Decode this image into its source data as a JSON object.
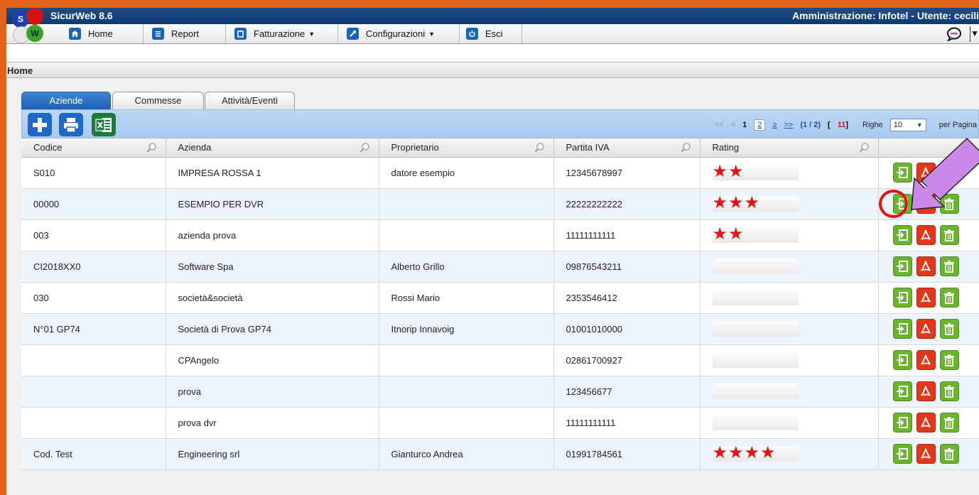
{
  "app": {
    "title": "SicurWeb 8.6",
    "admin_info": "Amministrazione: Infotel - Utente: cecili",
    "logo_letters": [
      "S",
      "W"
    ]
  },
  "menu": {
    "items": [
      {
        "label": "Home",
        "icon": "home-icon",
        "dropdown": false
      },
      {
        "label": "Report",
        "icon": "report-icon",
        "dropdown": false
      },
      {
        "label": "Fatturazione",
        "icon": "clipboard-icon",
        "dropdown": true
      },
      {
        "label": "Configurazioni",
        "icon": "wrench-icon",
        "dropdown": true
      },
      {
        "label": "Esci",
        "icon": "power-icon",
        "dropdown": false
      }
    ]
  },
  "page": {
    "title": "Home"
  },
  "tabs": [
    {
      "label": "Aziende",
      "active": true
    },
    {
      "label": "Commesse",
      "active": false
    },
    {
      "label": "Attività/Eventi",
      "active": false
    }
  ],
  "pager": {
    "first": "<<",
    "prev": "<",
    "current": "1",
    "page2": "2",
    "next": "≥",
    "last": ">>",
    "info": "(1 / 2)",
    "total_open": "[",
    "total": "11",
    "total_close": "]",
    "rows_label": "Righe",
    "per_page": "10",
    "per_page_label": "per Pagina"
  },
  "table": {
    "columns": [
      "Codice",
      "Azienda",
      "Proprietario",
      "Partita IVA",
      "Rating"
    ],
    "rows": [
      {
        "codice": "S010",
        "azienda": "IMPRESA ROSSA 1",
        "proprietario": "datore esempio",
        "piva": "12345678997",
        "rating": 2
      },
      {
        "codice": "00000",
        "azienda": "ESEMPIO PER DVR",
        "proprietario": "",
        "piva": "22222222222",
        "rating": 3
      },
      {
        "codice": "003",
        "azienda": "azienda prova",
        "proprietario": "",
        "piva": "11111111111",
        "rating": 2
      },
      {
        "codice": "CI2018XX0",
        "azienda": "Software Spa",
        "proprietario": "Alberto Grillo",
        "piva": "09876543211",
        "rating": 0
      },
      {
        "codice": "030",
        "azienda": "società&società",
        "proprietario": "Rossi Mario",
        "piva": "2353546412",
        "rating": 0
      },
      {
        "codice": "N°01 GP74",
        "azienda": "Società di Prova GP74",
        "proprietario": "Itnorip Innavoig",
        "piva": "01001010000",
        "rating": 0
      },
      {
        "codice": "",
        "azienda": "CPAngelo",
        "proprietario": "",
        "piva": "02861700927",
        "rating": 0
      },
      {
        "codice": "",
        "azienda": "prova",
        "proprietario": "",
        "piva": "123456677",
        "rating": 0
      },
      {
        "codice": "",
        "azienda": "prova dvr",
        "proprietario": "",
        "piva": "11111111111",
        "rating": 0
      },
      {
        "codice": "Cod. Test",
        "azienda": "Engineering srl",
        "proprietario": "Gianturco Andrea",
        "piva": "01991784561",
        "rating": 4
      }
    ]
  },
  "colors": {
    "titlebar": "#1d4e8c",
    "toolbar": "#bcd7f5",
    "star": "#e01414",
    "action_green": "#6ab42e",
    "action_red": "#e0381c",
    "annotation_ring": "#e81010",
    "annotation_arrow": "#cc88e8"
  }
}
